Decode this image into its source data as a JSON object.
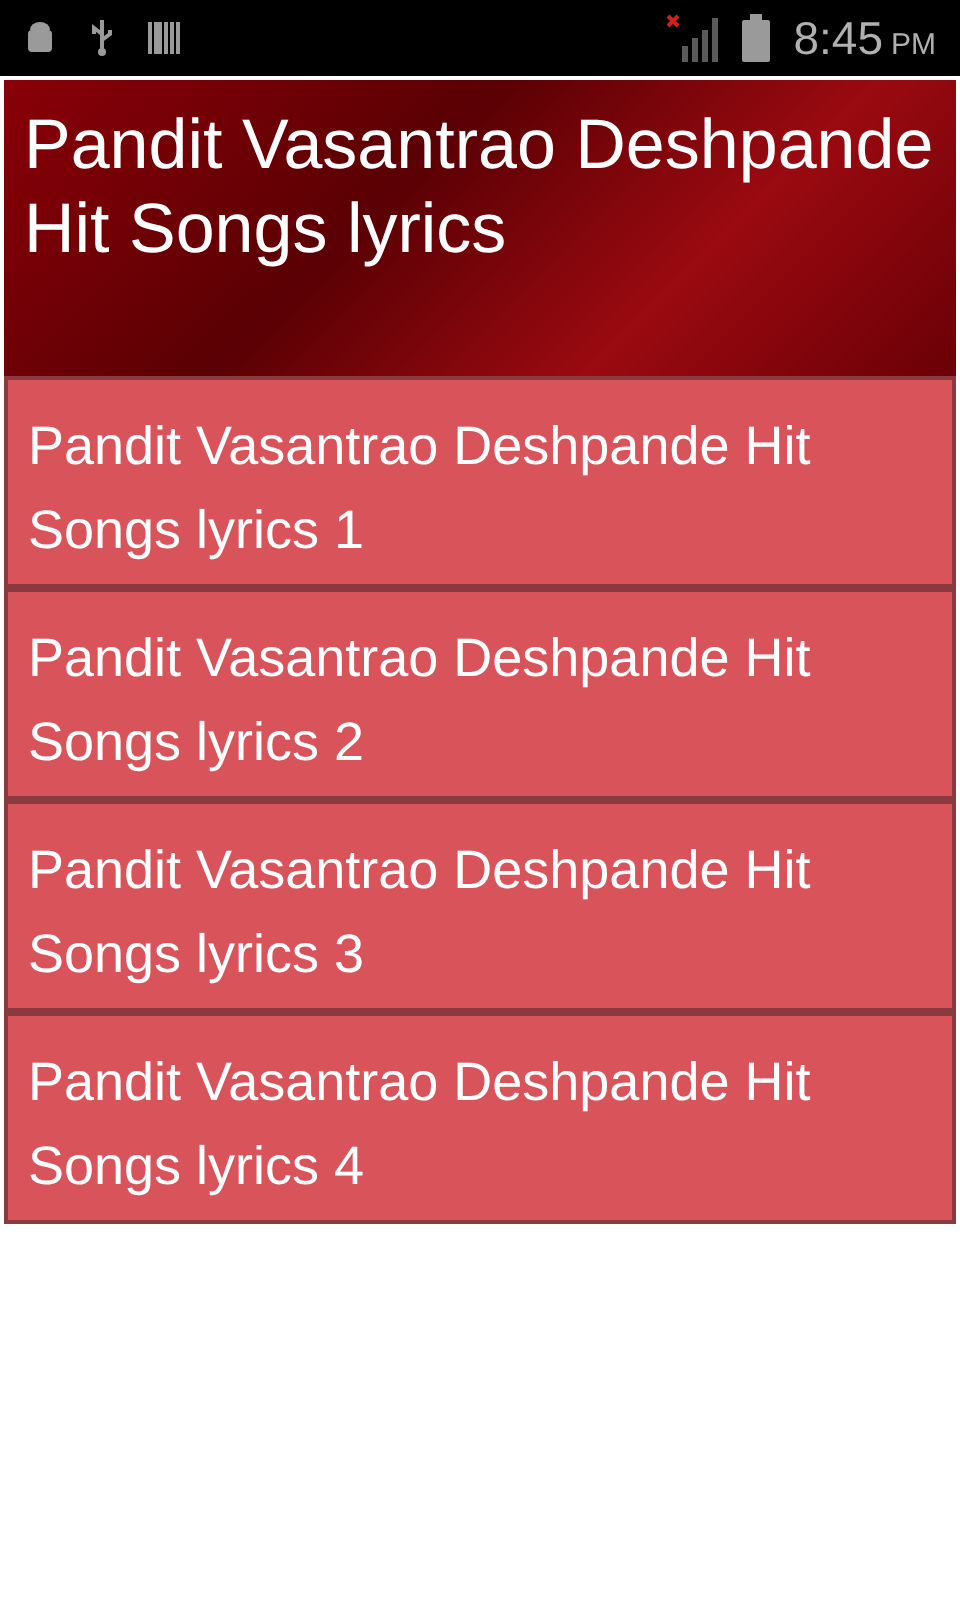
{
  "status_bar": {
    "time": "8:45",
    "period": "PM"
  },
  "header": {
    "title": "Pandit Vasantrao Deshpande Hit Songs lyrics"
  },
  "items": [
    {
      "label": "Pandit Vasantrao Deshpande Hit Songs lyrics 1"
    },
    {
      "label": "Pandit Vasantrao Deshpande Hit Songs lyrics 2"
    },
    {
      "label": "Pandit Vasantrao Deshpande Hit Songs lyrics 3"
    },
    {
      "label": "Pandit Vasantrao Deshpande Hit Songs lyrics 4"
    }
  ]
}
